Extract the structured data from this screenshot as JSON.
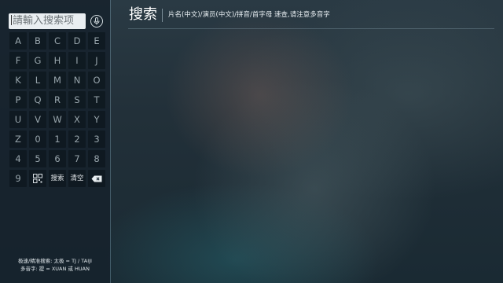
{
  "search": {
    "placeholder": "請輸入搜索项"
  },
  "header": {
    "title": "搜索",
    "subtitle": "片名(中文)/演员(中文)/拼音/首字母 速查,请注意多音字"
  },
  "keyboard": {
    "rows": [
      [
        "A",
        "B",
        "C",
        "D",
        "E"
      ],
      [
        "F",
        "G",
        "H",
        "I",
        "J"
      ],
      [
        "K",
        "L",
        "M",
        "N",
        "O"
      ],
      [
        "P",
        "Q",
        "R",
        "S",
        "T"
      ],
      [
        "U",
        "V",
        "W",
        "X",
        "Y"
      ],
      [
        "Z",
        "0",
        "1",
        "2",
        "3"
      ],
      [
        "4",
        "5",
        "6",
        "7",
        "8"
      ]
    ],
    "last_row": {
      "digit": "9",
      "search_label": "搜索",
      "clear_label": "清空"
    }
  },
  "hints": {
    "line1": "极速/精准搜索: 太极 = TJ / TAIJI",
    "line2": "多音字: 提 = XUAN 或 HUAN"
  },
  "icons": {
    "voice": "microphone-icon",
    "qr": "qr-code-icon",
    "backspace": "backspace-icon"
  },
  "colors": {
    "panel": "#16222c",
    "key_bg": "#0a1218",
    "text": "#98a5ac",
    "input_bg": "#e9eef1"
  }
}
